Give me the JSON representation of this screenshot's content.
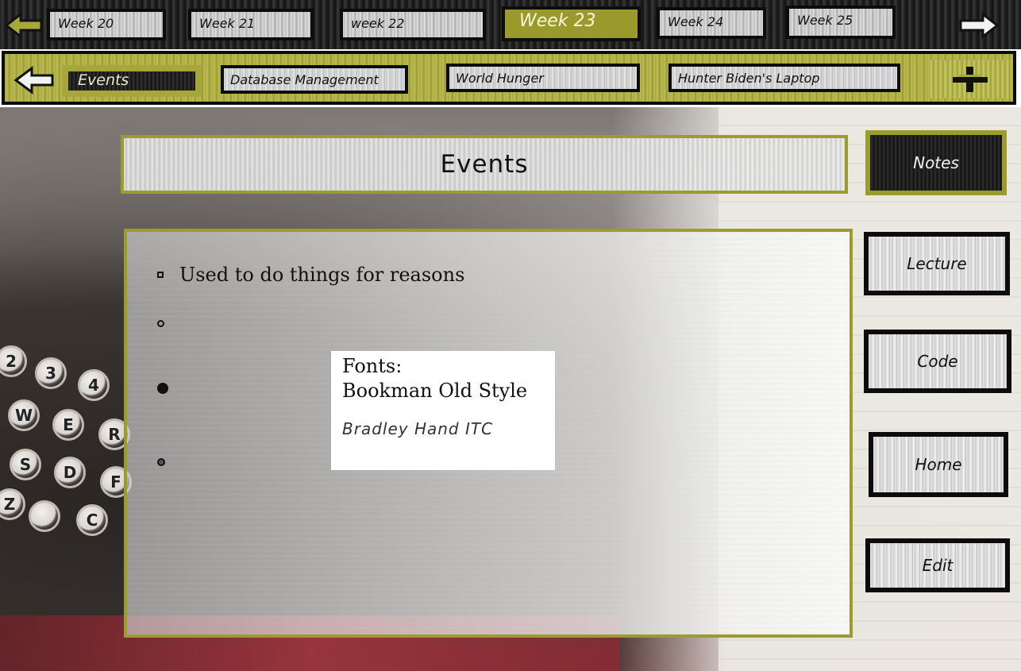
{
  "weeks": {
    "prev_icon": "left-arrow-icon",
    "next_icon": "right-arrow-icon",
    "tabs": [
      {
        "label": "Week 20",
        "active": false
      },
      {
        "label": "Week 21",
        "active": false
      },
      {
        "label": "week 22",
        "active": false
      },
      {
        "label": "Week 23",
        "active": true
      },
      {
        "label": "Week 24",
        "active": false
      },
      {
        "label": "Week 25",
        "active": false
      }
    ]
  },
  "topics": {
    "back_icon": "left-arrow-icon",
    "add_icon": "plus-icon",
    "tabs": [
      {
        "label": "Events",
        "active": true
      },
      {
        "label": "Database Management",
        "active": false
      },
      {
        "label": "World Hunger",
        "active": false
      },
      {
        "label": "Hunter Biden's Laptop",
        "active": false
      }
    ]
  },
  "page": {
    "title": "Events"
  },
  "content": {
    "bullets": [
      {
        "style": "square",
        "text": "Used to do things for reasons"
      },
      {
        "style": "circle",
        "text": ""
      },
      {
        "style": "dot",
        "text": ""
      },
      {
        "style": "small",
        "text": ""
      }
    ],
    "font_note": {
      "line1": "Fonts:",
      "line2": "Bookman Old Style",
      "line3": "Bradley Hand ITC"
    }
  },
  "sidebar": {
    "buttons": [
      {
        "label": "Notes",
        "active": true
      },
      {
        "label": "Lecture",
        "active": false
      },
      {
        "label": "Code",
        "active": false
      },
      {
        "label": "Home",
        "active": false
      },
      {
        "label": "Edit",
        "active": false
      }
    ]
  },
  "colors": {
    "accent_olive": "#9b9b2e",
    "bar_dark": "#1c1c1c"
  }
}
